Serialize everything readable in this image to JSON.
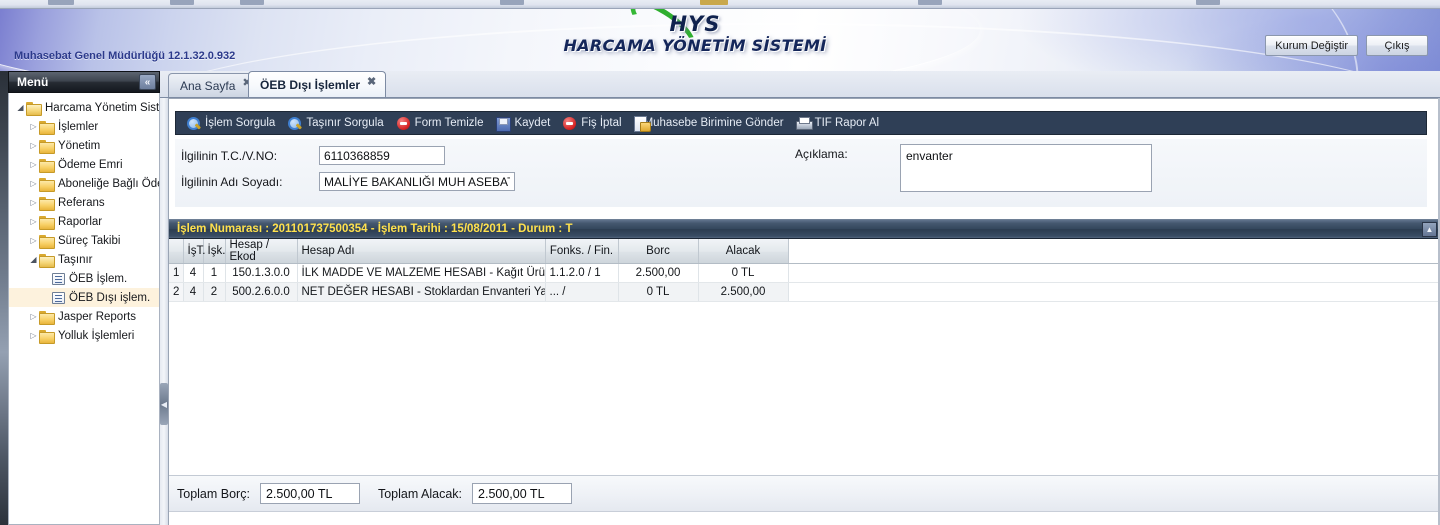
{
  "banner": {
    "logo_main": "HYS",
    "logo_sub": "HARCAMA YÖNETİM SİSTEMİ",
    "logo_arc_icon": "green-swoosh-icon",
    "version": "Muhasebat Genel Müdürlüğü 12.1.32.0.932",
    "buttons": [
      {
        "label": "Kurum Değiştir",
        "name": "kurum-degistir-button"
      },
      {
        "label": "Çıkış",
        "name": "cikis-button"
      }
    ]
  },
  "menu": {
    "title": "Menü",
    "collapse_icon": "chevron-double-left-icon",
    "tree": [
      {
        "label": "Harcama Yönetim Sistem",
        "type": "folder-open",
        "depth": 0,
        "expanded": true,
        "selected": false
      },
      {
        "label": "İşlemler",
        "type": "folder",
        "depth": 1,
        "expanded": false,
        "selected": false
      },
      {
        "label": "Yönetim",
        "type": "folder",
        "depth": 1,
        "expanded": false,
        "selected": false
      },
      {
        "label": "Ödeme Emri",
        "type": "folder",
        "depth": 1,
        "expanded": false,
        "selected": false
      },
      {
        "label": "Aboneliğe Bağlı Öder",
        "type": "folder",
        "depth": 1,
        "expanded": false,
        "selected": false
      },
      {
        "label": "Referans",
        "type": "folder",
        "depth": 1,
        "expanded": false,
        "selected": false
      },
      {
        "label": "Raporlar",
        "type": "folder",
        "depth": 1,
        "expanded": false,
        "selected": false
      },
      {
        "label": "Süreç Takibi",
        "type": "folder",
        "depth": 1,
        "expanded": false,
        "selected": false
      },
      {
        "label": "Taşınır",
        "type": "folder-open",
        "depth": 1,
        "expanded": true,
        "selected": false
      },
      {
        "label": "ÖEB İşlem.",
        "type": "doc",
        "depth": 2,
        "expanded": false,
        "selected": false
      },
      {
        "label": "ÖEB Dışı işlem.",
        "type": "doc",
        "depth": 2,
        "expanded": false,
        "selected": true
      },
      {
        "label": "Jasper Reports",
        "type": "folder",
        "depth": 1,
        "expanded": false,
        "selected": false
      },
      {
        "label": "Yolluk İşlemleri",
        "type": "folder",
        "depth": 1,
        "expanded": false,
        "selected": false
      }
    ]
  },
  "tabs": [
    {
      "label": "Ana Sayfa",
      "active": false,
      "close_icon": "close-icon"
    },
    {
      "label": "ÖEB Dışı İşlemler",
      "active": true,
      "close_icon": "close-icon"
    }
  ],
  "toolbar": {
    "items": [
      {
        "label": "İşlem Sorgula",
        "icon": "search-icon",
        "name": "islem-sorgula-button"
      },
      {
        "label": "Taşınır Sorgula",
        "icon": "search-icon",
        "name": "tasinir-sorgula-button"
      },
      {
        "label": "Form Temizle",
        "icon": "cancel-icon",
        "name": "form-temizle-button"
      },
      {
        "label": "Kaydet",
        "icon": "save-icon",
        "name": "kaydet-button"
      },
      {
        "label": "Fiş İptal",
        "icon": "cancel-icon",
        "name": "fis-iptal-button"
      },
      {
        "label": "Muhasebe Birimine Gönder",
        "icon": "send-icon",
        "name": "muhasebe-birimine-gonder-button"
      },
      {
        "label": "TIF Rapor Al",
        "icon": "print-icon",
        "name": "tif-rapor-al-button"
      }
    ]
  },
  "form": {
    "tc_vno_label": "İlgilinin T.C./V.NO:",
    "tc_vno_value": "6110368859",
    "ad_soyad_label": "İlgilinin Adı Soyadı:",
    "ad_soyad_value": "MALİYE BAKANLIĞI MUH ASEBAT (",
    "aciklama_label": "Açıklama:",
    "aciklama_value": "envanter"
  },
  "transaction_bar": {
    "text": "İşlem Numarası : 201101737500354 - İşlem Tarihi : 15/08/2011 - Durum : T",
    "islem_numarasi": "201101737500354",
    "islem_tarihi": "15/08/2011",
    "durum": "T",
    "collapse_icon": "collapse-panel-icon",
    "accent_color": "#ffe14d"
  },
  "grid": {
    "columns": [
      "",
      "İşT.",
      "İşk.",
      "Hesap / Ekod",
      "Hesap Adı",
      "Fonks. / Fin.",
      "Borc",
      "Alacak"
    ],
    "rows": [
      {
        "num": "1",
        "ist": "4",
        "isk": "1",
        "hesap_ekod": "150.1.3.0.0",
        "hesap_adi": "İLK MADDE VE MALZEME HESABI - Kağıt Ürünler",
        "fonks_fin": "1.1.2.0 / 1",
        "borc": "2.500,00",
        "alacak": "0 TL"
      },
      {
        "num": "2",
        "ist": "4",
        "isk": "2",
        "hesap_ekod": "500.2.6.0.0",
        "hesap_adi": "NET DEĞER HESABI - Stoklardan Envanteri Yapılan",
        "fonks_fin": "... /",
        "borc": "0 TL",
        "alacak": "2.500,00"
      }
    ]
  },
  "totals": {
    "borc_label": "Toplam Borç:",
    "borc_value": "2.500,00 TL",
    "alacak_label": "Toplam Alacak:",
    "alacak_value": "2.500,00 TL"
  }
}
